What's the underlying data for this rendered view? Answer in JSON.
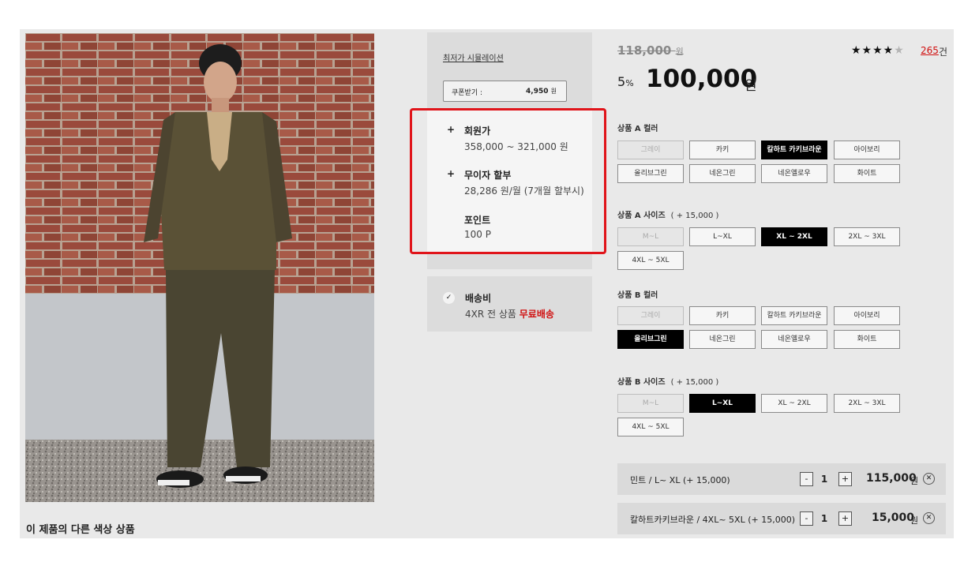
{
  "gallery": {
    "other_colors_title": "이 제품의 다른 색상 상품"
  },
  "benefits": {
    "simulation_link": "최저가 시뮬레이션",
    "coupon_label": "쿠폰받기 :",
    "coupon_amount": "4,950",
    "coupon_unit": "원",
    "items": [
      {
        "icon": "+",
        "title": "회원가",
        "desc": "358,000 ~ 321,000 원"
      },
      {
        "icon": "+",
        "title": "무이자 할부",
        "desc": "28,286 원/월 (7개월 할부시)"
      },
      {
        "icon": "",
        "title": "포인트",
        "desc": "100 P"
      }
    ],
    "highlight_color": "#e0141a"
  },
  "shipping": {
    "title": "배송비",
    "desc_prefix": "4XR 전 상품 ",
    "desc_highlight": "무료배송"
  },
  "price": {
    "original": "118,000",
    "original_unit": "원",
    "discount_value": "5",
    "discount_unit": "%",
    "sale": "100,000",
    "sale_unit": "원"
  },
  "rating": {
    "stars_filled": "★★★",
    "star_half": "★",
    "star_empty": "★",
    "score_out_of_5": 3.5,
    "review_count": "265",
    "review_unit": "건"
  },
  "options": {
    "a_color": {
      "label": "상품 A 컬러",
      "buttons": [
        "그레이",
        "카키",
        "칼하트 카키브라운",
        "아이보리",
        "올리브그린",
        "네온그린",
        "네온옐로우",
        "화이트"
      ],
      "disabled": "그레이",
      "selected": "칼하트 카키브라운"
    },
    "a_size": {
      "label": "상품 A 사이즈",
      "extra": "( + 15,000 )",
      "buttons": [
        "M~L",
        "L~XL",
        "XL ~ 2XL",
        "2XL ~ 3XL",
        "4XL ~ 5XL"
      ],
      "disabled": "M~L",
      "selected": "XL ~ 2XL"
    },
    "b_color": {
      "label": "상품 B 컬러",
      "buttons": [
        "그레이",
        "카키",
        "칼하트 카키브라운",
        "아이보리",
        "올리브그린",
        "네온그린",
        "네온옐로우",
        "화이트"
      ],
      "disabled": "그레이",
      "selected": "올리브그린"
    },
    "b_size": {
      "label": "상품 B 사이즈",
      "extra": "( + 15,000 )",
      "buttons": [
        "M~L",
        "L~XL",
        "XL ~ 2XL",
        "2XL ~ 3XL",
        "4XL ~ 5XL"
      ],
      "disabled": "M~L",
      "selected": "L~XL"
    }
  },
  "cart": [
    {
      "name": "민트  /  L~ XL (+ 15,000)",
      "minus": "-",
      "qty": "1",
      "plus": "+",
      "price": "115,000",
      "unit": "원",
      "close": "✕"
    },
    {
      "name": "칼하트카키브라운  /  4XL~ 5XL (+ 15,000)",
      "minus": "-",
      "qty": "1",
      "plus": "+",
      "price": "15,000",
      "unit": "원",
      "close": "✕"
    }
  ]
}
